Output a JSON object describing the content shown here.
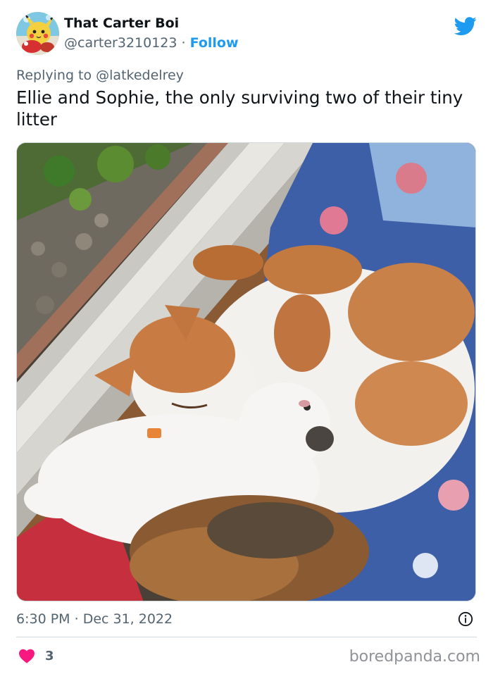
{
  "tweet": {
    "author": {
      "display_name": "That Carter Boi",
      "handle": "@carter3210123",
      "separator": " · ",
      "follow_label": "Follow",
      "avatar_icon": "pikachu-avatar"
    },
    "brand_icon": "twitter-bird-icon",
    "reply": {
      "prefix": "Replying to ",
      "mention": "@latkedelrey"
    },
    "text": "Ellie and Sophie, the only surviving two of their tiny litter",
    "photo": {
      "alt": "two cats"
    },
    "timestamp": {
      "time": "6:30 PM",
      "separator": " · ",
      "date": "Dec 31, 2022"
    },
    "info_icon": "info-icon",
    "likes": {
      "icon": "heart-icon",
      "count": "3"
    }
  },
  "watermark": "boredpanda.com",
  "colors": {
    "accent": "#1d9bf0",
    "text": "#0f1419",
    "muted": "#536471",
    "heart": "#f91880",
    "divider": "#cfd9de"
  }
}
